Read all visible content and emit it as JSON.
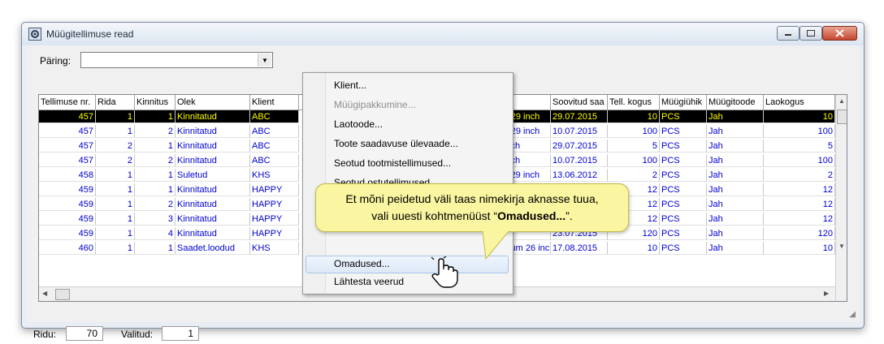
{
  "window": {
    "title": "Müügitellimuse read"
  },
  "query": {
    "label": "Päring:",
    "value": ""
  },
  "table": {
    "columns": [
      "Tellimuse nr.",
      "Rida",
      "Kinnitus",
      "Olek",
      "Klient",
      "",
      "",
      "",
      "Soovitud saa",
      "Tell. kogus",
      "Müügiühik",
      "Müügitoode",
      "Laokogus"
    ],
    "rows": [
      [
        "457",
        "1",
        "1",
        "Kinnitatud",
        "ABC",
        "L 29 inch",
        "29.07.2015",
        "10",
        "PCS",
        "Jah",
        "10"
      ],
      [
        "457",
        "1",
        "2",
        "Kinnitatud",
        "ABC",
        "L 29 inch",
        "10.07.2015",
        "100",
        "PCS",
        "Jah",
        "100"
      ],
      [
        "457",
        "2",
        "1",
        "Kinnitatud",
        "ABC",
        "inch",
        "29.07.2015",
        "5",
        "PCS",
        "Jah",
        "5"
      ],
      [
        "457",
        "2",
        "2",
        "Kinnitatud",
        "ABC",
        "inch",
        "10.07.2015",
        "100",
        "PCS",
        "Jah",
        "100"
      ],
      [
        "458",
        "1",
        "1",
        "Suletud",
        "KHS",
        "s 29 inch",
        "13.06.2012",
        "2",
        "PCS",
        "Jah",
        "2"
      ],
      [
        "459",
        "1",
        "1",
        "Kinnitatud",
        "HAPPY",
        "",
        "",
        "12",
        "PCS",
        "Jah",
        "12"
      ],
      [
        "459",
        "1",
        "2",
        "Kinnitatud",
        "HAPPY",
        "",
        "",
        "12",
        "PCS",
        "Jah",
        "12"
      ],
      [
        "459",
        "1",
        "3",
        "Kinnitatud",
        "HAPPY",
        "",
        "",
        "12",
        "PCS",
        "Jah",
        "12"
      ],
      [
        "459",
        "1",
        "4",
        "Kinnitatud",
        "HAPPY",
        "h",
        "23.07.2015",
        "120",
        "PCS",
        "Jah",
        "120"
      ],
      [
        "460",
        "1",
        "1",
        "Saadet.loodud",
        "KHS",
        "nium 26 inc",
        "17.08.2015",
        "10",
        "PCS",
        "Jah",
        "10"
      ]
    ]
  },
  "context_menu": {
    "items": [
      "Klient...",
      "Müügipakkumine...",
      "Laotoode...",
      "Toote saadavuse ülevaade...",
      "Seotud tootmistellimused...",
      "Seotud ostutellimused...",
      "Omadused...",
      "Lähtesta veerud"
    ]
  },
  "tooltip": {
    "line1": "Et mõni peidetud väli taas nimekirja aknasse tuua,",
    "line2_prefix": "vali uuesti kohtmenüüst “",
    "line2_bold": "Omadused...",
    "line2_suffix": "”."
  },
  "status": {
    "rows_label": "Ridu:",
    "rows_value": "70",
    "selected_label": "Valitud:",
    "selected_value": "1"
  },
  "colors": {
    "selected_row_bg": "#000000",
    "selected_row_fg": "#ffff00",
    "cell_text": "#0000d0",
    "tooltip_bg": "#faf5a0"
  }
}
